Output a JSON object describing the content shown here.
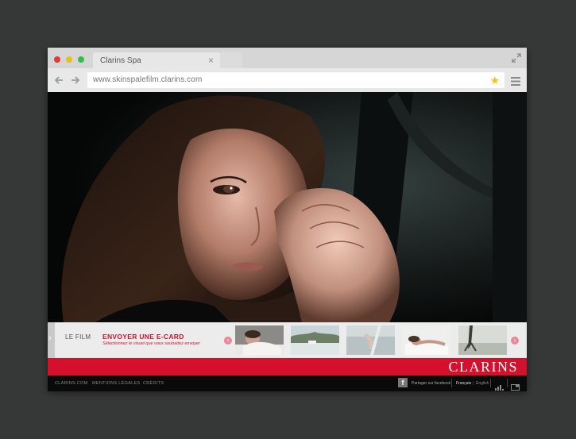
{
  "browser": {
    "tab_title": "Clarins Spa",
    "tab_close": "×",
    "url": "www.skinspalefilm.clarins.com",
    "star_glyph": "★",
    "colors": {
      "close": "#e53a32",
      "minimize": "#e8c11e",
      "maximize": "#2fbf4a",
      "star": "#f2c31b"
    }
  },
  "site": {
    "nav": {
      "film_label": "LE FILM",
      "ecard_title": "ENVOYER UNE E-CARD",
      "ecard_subtitle": "Sélectionnez le visuel que vous souhaitez envoyer",
      "prev_glyph": "‹",
      "next_glyph": "›",
      "side_glyph": "›"
    },
    "thumbnails": [
      {
        "name": "thumb-spa-massage"
      },
      {
        "name": "thumb-lake-landscape"
      },
      {
        "name": "thumb-hand-water"
      },
      {
        "name": "thumb-woman-reclining"
      },
      {
        "name": "thumb-running-figure"
      }
    ],
    "brand": {
      "logo": "CLARINS",
      "color": "#d5102c"
    },
    "footer": {
      "links": [
        "CLARINS.COM",
        "MENTIONS LÉGALES",
        "CRÉDITS"
      ],
      "facebook_glyph": "f",
      "facebook_label": "Partager sur facebook",
      "lang_fr": "Français",
      "lang_en": "English"
    }
  }
}
